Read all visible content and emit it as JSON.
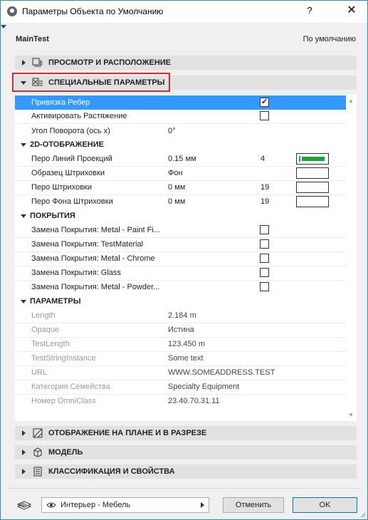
{
  "window": {
    "title": "Параметры Объекта по Умолчанию",
    "help_label": "?",
    "close_label": "✕"
  },
  "header": {
    "object_name": "MainTest",
    "default_label": "По умолчанию"
  },
  "sections": {
    "preview": "ПРОСМОТР И РАСПОЛОЖЕНИЕ",
    "custom": "СПЕЦИАЛЬНЫЕ ПАРАМЕТРЫ",
    "floorplan": "ОТОБРАЖЕНИЕ НА ПЛАНЕ И В РАЗРЕЗЕ",
    "model": "МОДЕЛЬ",
    "classification": "КЛАССИФИКАЦИЯ И СВОЙСТВА"
  },
  "params": {
    "top": [
      {
        "label": "Привязка Ребер",
        "checked": true
      },
      {
        "label": "Активировать Растяжение",
        "checked": false
      },
      {
        "label": "Угол Поворота (ось x)",
        "value": "0°"
      }
    ],
    "display_group": "2D-ОТОБРАЖЕНИЕ",
    "display": [
      {
        "label": "Перо Линий Проекций",
        "value": "0.15 мм",
        "num": "4"
      },
      {
        "label": "Образец Штриховки",
        "value": "Фон",
        "num": ""
      },
      {
        "label": "Перо Штриховки",
        "value": "0 мм",
        "num": "19"
      },
      {
        "label": "Перо Фона Штриховки",
        "value": "0 мм",
        "num": "19"
      }
    ],
    "surfaces_group": "ПОКРЫТИЯ",
    "surfaces": [
      {
        "label": "Замена Покрытия: Metal - Paint Fi..."
      },
      {
        "label": "Замена Покрытия: TestMaterial"
      },
      {
        "label": "Замена Покрытия: Metal - Chrome"
      },
      {
        "label": "Замена Покрытия: Glass"
      },
      {
        "label": "Замена Покрытия: Metal - Powder..."
      }
    ],
    "parameters_group": "ПАРАМЕТРЫ",
    "parameters": [
      {
        "label": "Length",
        "value": "2.184 m"
      },
      {
        "label": "Opaque",
        "value": "Истина"
      },
      {
        "label": "TestLength",
        "value": "123.450 m"
      },
      {
        "label": "TestStringInstance",
        "value": "Some text"
      },
      {
        "label": "URL",
        "value": "WWW.SOMEADDRESS.TEST"
      },
      {
        "label": "Категория Семейства",
        "value": "Specialty Equipment"
      },
      {
        "label": "Номер OmniClass",
        "value": "23.40.70.31.11"
      }
    ]
  },
  "pen_color": "#19a53a",
  "selection_color": "#3399ff",
  "highlight_color": "#e0272e",
  "footer": {
    "layer_value": "Интерьер - Мебель",
    "cancel_label": "Отменить",
    "ok_label": "OK"
  }
}
